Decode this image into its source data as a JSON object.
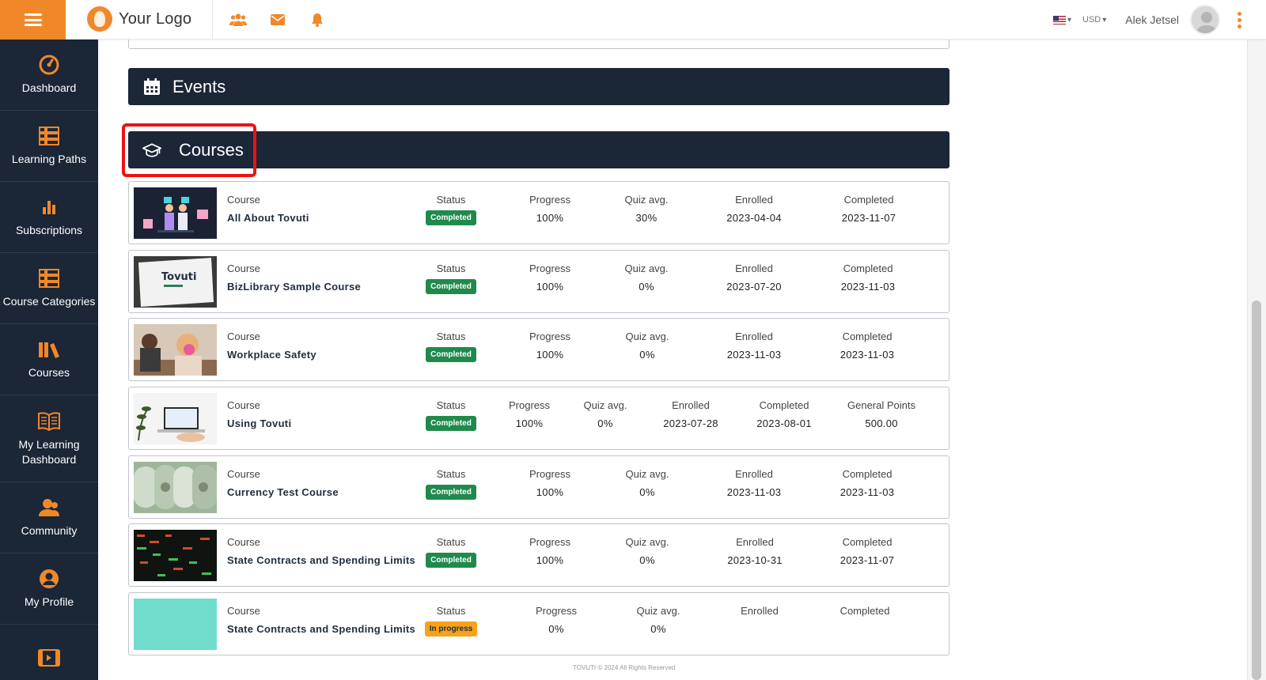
{
  "header": {
    "logo_text": "Your Logo",
    "currency": "USD",
    "username": "Alek Jetsel"
  },
  "sidebar": {
    "items": [
      {
        "label": "Dashboard",
        "icon": "gauge-icon"
      },
      {
        "label": "Learning Paths",
        "icon": "list-grid-icon"
      },
      {
        "label": "Subscriptions",
        "icon": "bar-chart-icon"
      },
      {
        "label": "Course Categories",
        "icon": "list-grid-icon"
      },
      {
        "label": "Courses",
        "icon": "books-icon"
      },
      {
        "label": "My Learning Dashboard",
        "icon": "open-book-icon"
      },
      {
        "label": "Community",
        "icon": "people-icon"
      },
      {
        "label": "My Profile",
        "icon": "user-circle-icon"
      },
      {
        "label": "",
        "icon": "film-icon"
      }
    ]
  },
  "sections": {
    "events_title": "Events",
    "courses_title": "Courses"
  },
  "labels": {
    "course": "Course",
    "status": "Status",
    "progress": "Progress",
    "quiz_avg": "Quiz avg.",
    "enrolled": "Enrolled",
    "completed": "Completed",
    "general_points": "General Points"
  },
  "courses": [
    {
      "name": "All About Tovuti",
      "status": "Completed",
      "progress": "100%",
      "quiz": "30%",
      "enrolled": "2023-04-04",
      "completed": "2023-11-07"
    },
    {
      "name": "BizLibrary Sample Course",
      "status": "Completed",
      "progress": "100%",
      "quiz": "0%",
      "enrolled": "2023-07-20",
      "completed": "2023-11-03",
      "thumb_text": "Tovuti"
    },
    {
      "name": "Workplace Safety",
      "status": "Completed",
      "progress": "100%",
      "quiz": "0%",
      "enrolled": "2023-11-03",
      "completed": "2023-11-03"
    },
    {
      "name": "Using Tovuti",
      "status": "Completed",
      "progress": "100%",
      "quiz": "0%",
      "enrolled": "2023-07-28",
      "completed": "2023-08-01",
      "points": "500.00"
    },
    {
      "name": "Currency Test Course",
      "status": "Completed",
      "progress": "100%",
      "quiz": "0%",
      "enrolled": "2023-11-03",
      "completed": "2023-11-03"
    },
    {
      "name": "State Contracts and Spending Limits",
      "status": "Completed",
      "progress": "100%",
      "quiz": "0%",
      "enrolled": "2023-10-31",
      "completed": "2023-11-07"
    },
    {
      "name": "State Contracts and Spending Limits",
      "status": "In progress",
      "progress": "0%",
      "quiz": "0%",
      "enrolled": "",
      "completed": ""
    }
  ],
  "colors": {
    "accent": "#f0882a",
    "sidebar_bg": "#1b2637",
    "completed_badge": "#1f8a4c",
    "inprogress_badge": "#f7a21b",
    "highlight": "#ee1111"
  },
  "footer": "TOVUTI © 2024 All Rights Reserved"
}
